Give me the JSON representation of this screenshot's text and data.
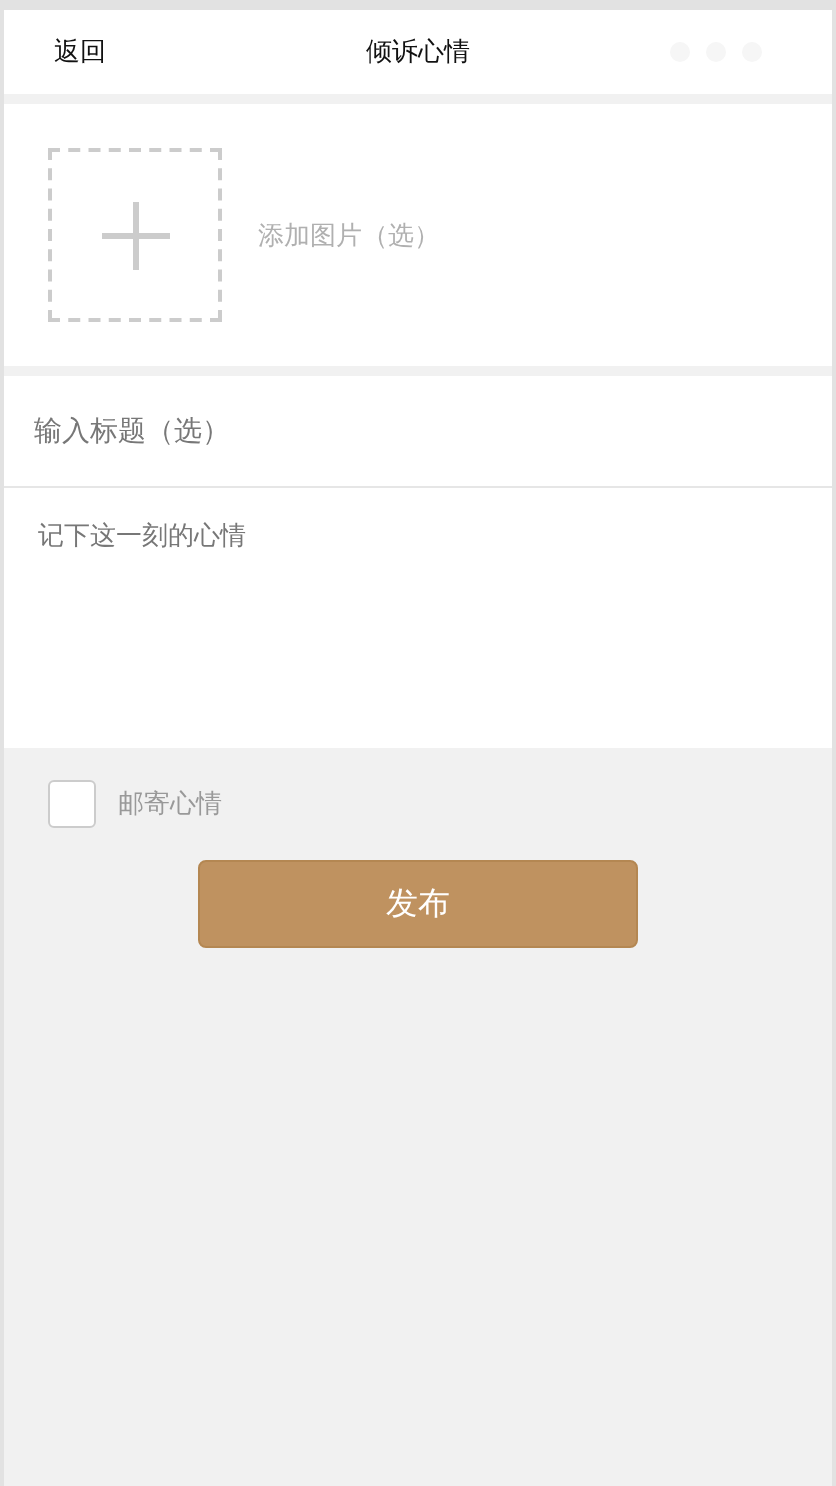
{
  "header": {
    "back": "返回",
    "title": "倾诉心情"
  },
  "image_picker": {
    "label": "添加图片（选）"
  },
  "title_field": {
    "placeholder": "输入标题（选）"
  },
  "content_field": {
    "placeholder": "记下这一刻的心情"
  },
  "mail_option": {
    "label": "邮寄心情",
    "checked": false
  },
  "publish_button": "发布"
}
